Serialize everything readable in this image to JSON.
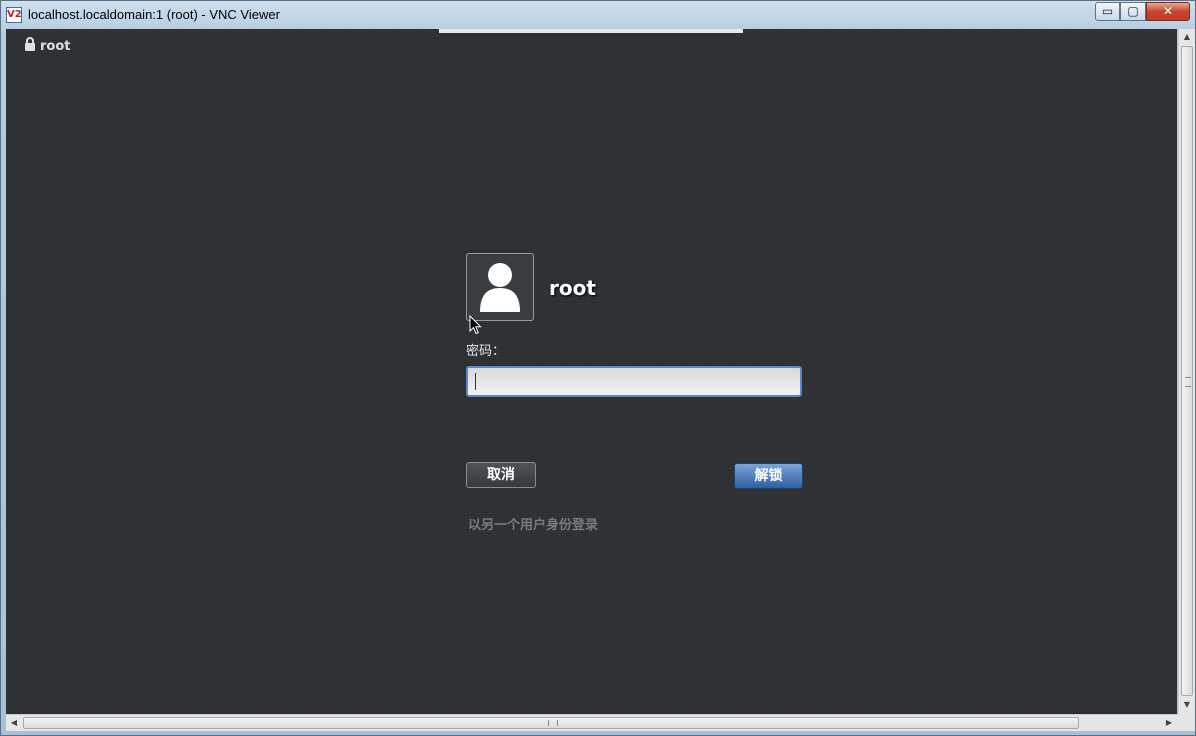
{
  "window": {
    "title": "localhost.localdomain:1 (root) - VNC Viewer",
    "app_icon_text": "V2",
    "buttons": {
      "minimize": "▭",
      "maximize": "▢",
      "close": "✕"
    }
  },
  "screen": {
    "top_user_label": "root",
    "lock_icon": "lock-icon",
    "username": "root",
    "avatar_icon": "user-avatar-icon",
    "password_label": "密码：",
    "password_value": "",
    "cancel_label": "取消",
    "unlock_label": "解锁",
    "switch_user_label": "以另一个用户身份登录"
  },
  "colors": {
    "background": "#2d3033",
    "unlock_button": "#3b6cb0",
    "input_focus_border": "#5c86c4"
  }
}
